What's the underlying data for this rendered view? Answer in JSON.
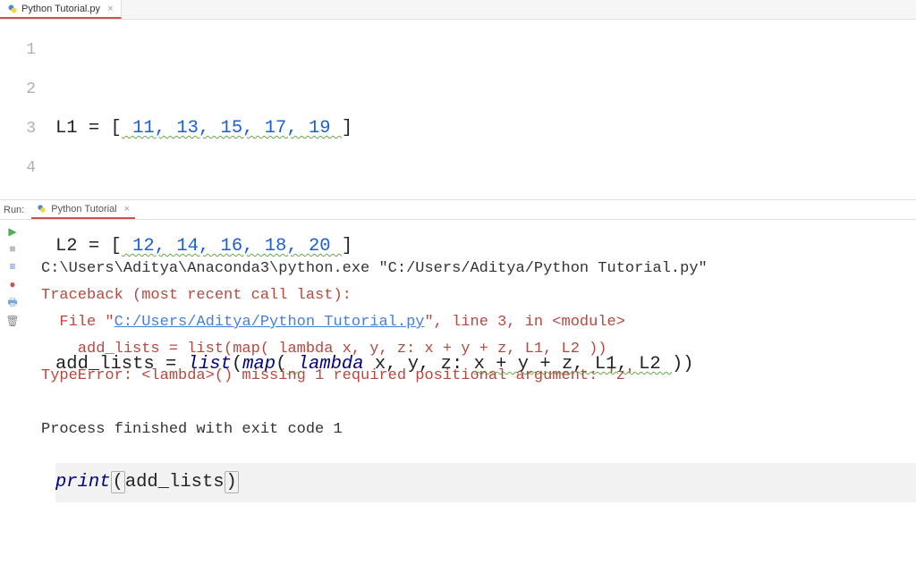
{
  "tabs": {
    "file": "Python Tutorial.py"
  },
  "gutter": {
    "l1": "1",
    "l2": "2",
    "l3": "3",
    "l4": "4"
  },
  "code": {
    "l1_id": "L1 ",
    "l1_eq": "= [",
    "l1_nums": " 11, 13, 15, 17, 19 ",
    "l1_close": "]",
    "l2_id": "L2 ",
    "l2_eq": "= [",
    "l2_nums": " 12, 14, 16, 18, 20 ",
    "l2_close": "]",
    "l3_id": "add_lists ",
    "l3_eq": "= ",
    "l3_list": "list",
    "l3_p1": "(",
    "l3_map": "map",
    "l3_p2": "(",
    "l3_space": " ",
    "l3_lambda": "lambda ",
    "l3_args": "x, y, z",
    "l3_colon": ": ",
    "l3_expr": "x + y + z, L1, L2 ",
    "l3_p3": "))",
    "l4_print": "print",
    "l4_p1": "(",
    "l4_arg": "add_lists",
    "l4_p2": ")"
  },
  "run": {
    "label": "Run:",
    "tab": "Python Tutorial"
  },
  "console": {
    "cmd": "C:\\Users\\Aditya\\Anaconda3\\python.exe \"C:/Users/Aditya/Python Tutorial.py\"",
    "tb_head": "Traceback (most recent call last):",
    "tb_file_pre": "  File \"",
    "tb_file_link": "C:/Users/Aditya/Python Tutorial.py",
    "tb_file_post": "\", line 3, in <module>",
    "tb_code": "    add_lists = list(map( lambda x, y, z: x + y + z, L1, L2 ))",
    "tb_err": "TypeError: <lambda>() missing 1 required positional argument: 'z'",
    "blank": "",
    "exit": "Process finished with exit code 1"
  },
  "icons": {
    "file_tab_close": "×",
    "run_tab_close": "×"
  }
}
